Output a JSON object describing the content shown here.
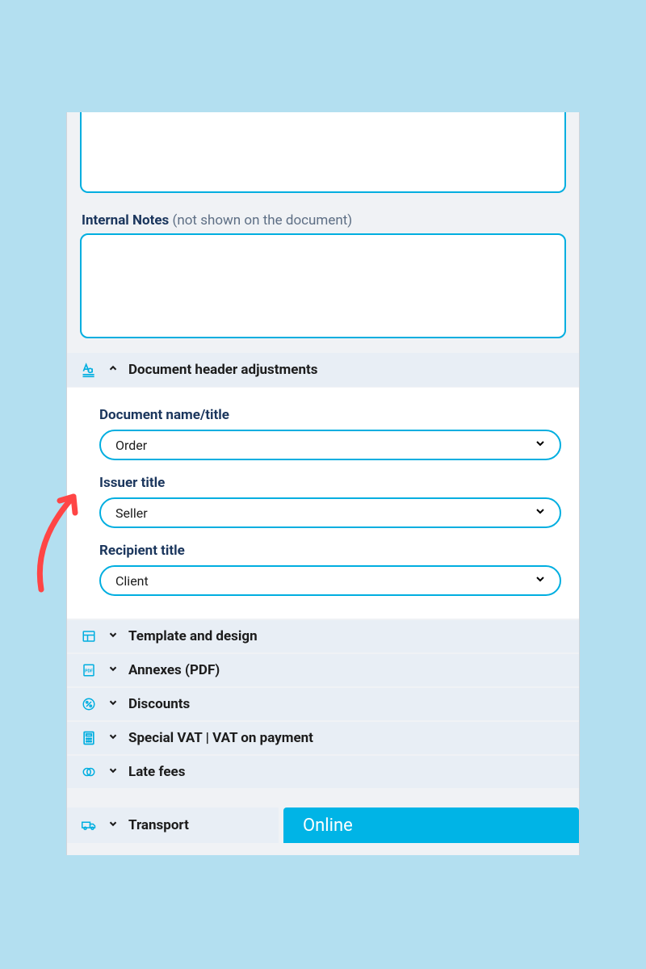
{
  "notes_label": {
    "title": "Internal Notes",
    "hint": "(not shown on the document)"
  },
  "header_adjustments": {
    "title": "Document header adjustments",
    "fields": {
      "document_title": {
        "label": "Document name/title",
        "value": "Order"
      },
      "issuer_title": {
        "label": "Issuer title",
        "value": "Seller"
      },
      "recipient_title": {
        "label": "Recipient title",
        "value": "Client"
      }
    }
  },
  "collapsed_sections": {
    "template": "Template and design",
    "annexes": "Annexes (PDF)",
    "discounts": "Discounts",
    "vat": "Special VAT | VAT on payment",
    "late_fees": "Late fees",
    "transport": "Transport"
  },
  "online_tab": "Online"
}
